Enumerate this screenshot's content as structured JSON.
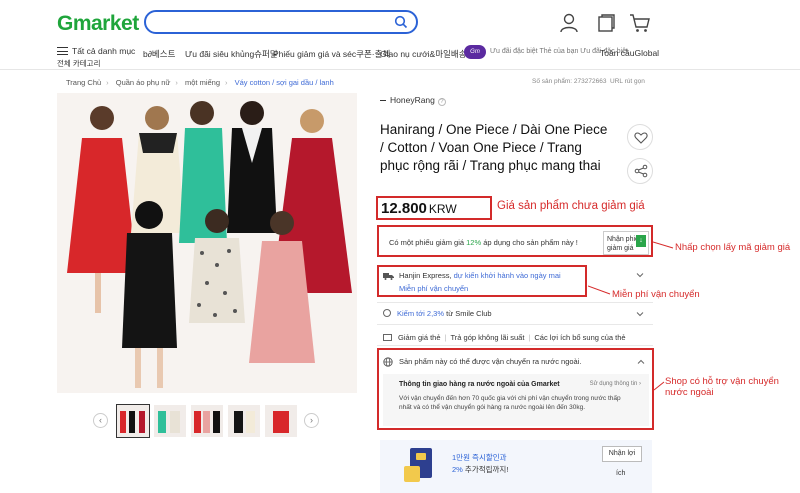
{
  "header": {
    "logo": "Gmarket",
    "search_placeholder": "",
    "icons": [
      "search-icon",
      "user-icon",
      "recent-items-icon",
      "cart-icon"
    ]
  },
  "nav": {
    "menu_label": "Tất cả danh mục",
    "menu_sub": "전체 카테고리",
    "items": [
      "b∂베스트",
      "Ưu đãi siêu khủng슈퍼딜",
      "Phiếu giảm giá và séc쿠폰·출첵",
      "Giao nụ cưới&마일배송만!",
      "Ưu đãi đặc biệt Thẻ của bạn Ưu đãi đặc biệt",
      "Toàn cầuGlobal"
    ],
    "badge_icon": "promo-badge-icon"
  },
  "breadcrumb": [
    "Trang Chủ",
    "Quần áo phụ nữ",
    "một miếng",
    "Váy cotton / sợi gai dầu / lanh"
  ],
  "meta": {
    "product_no": "Số sản phẩm: 273272663",
    "short_url": "URL rút gọn"
  },
  "product": {
    "brand": "HoneyRang",
    "title": "Hanirang / One Piece / Dài One Piece / Cotton / Voan One Piece / Trang phục rộng rãi / Trang phục mang thai",
    "price": "12.800",
    "currency": "KRW",
    "thumbnails": 5
  },
  "coupon": {
    "text_before": "Có một phiếu giảm giá ",
    "percent": "12%",
    "text_after": " áp dụng cho sản phẩm này !",
    "button": "Nhận phiếu giảm giá"
  },
  "shipping": {
    "carrier": "Hanjin Express, ",
    "schedule": "dự kiến khởi hành vào ngày mai",
    "free": "Miễn phí vận chuyển"
  },
  "rows": {
    "points_link": "Kiếm tới 2,3%",
    "points_rest": " từ Smile Club",
    "card_discount": "Giảm giá thẻ",
    "installment": "Trả góp không lãi suất",
    "card_benefits": "Các lợi ích bổ sung của thẻ"
  },
  "international": {
    "head": "Sản phẩm này có thể được vận chuyển ra nước ngoài.",
    "title": "Thông tin giao hàng ra nước ngoài của Gmarket",
    "more": "Sử dụng thông tin ›",
    "desc": "Với vận chuyển đến hơn 70 quốc gia với chi phí vận chuyển trong nước thấp nhất và có thể vận chuyển gói hàng ra nước ngoài lên đến 30kg."
  },
  "promo": {
    "line1": "1만원 즉시할인과",
    "line2_pct": "2%",
    "line2_rest": " 추가적립까지!",
    "button": "Nhận lợi",
    "button2": "ích"
  },
  "annotations": {
    "price": "Giá sản phẩm chưa giảm giá",
    "coupon": "Nhấp chọn lấy mã giảm giá",
    "shipping": "Miễn phí vận chuyển",
    "international": "Shop có hỗ trợ vận chuyển nước ngoài"
  },
  "colors": {
    "brand_green": "#1fa53b",
    "search_blue": "#2b62d6",
    "annotation_red": "#d62b2b",
    "link_blue": "#3f6bd6"
  }
}
